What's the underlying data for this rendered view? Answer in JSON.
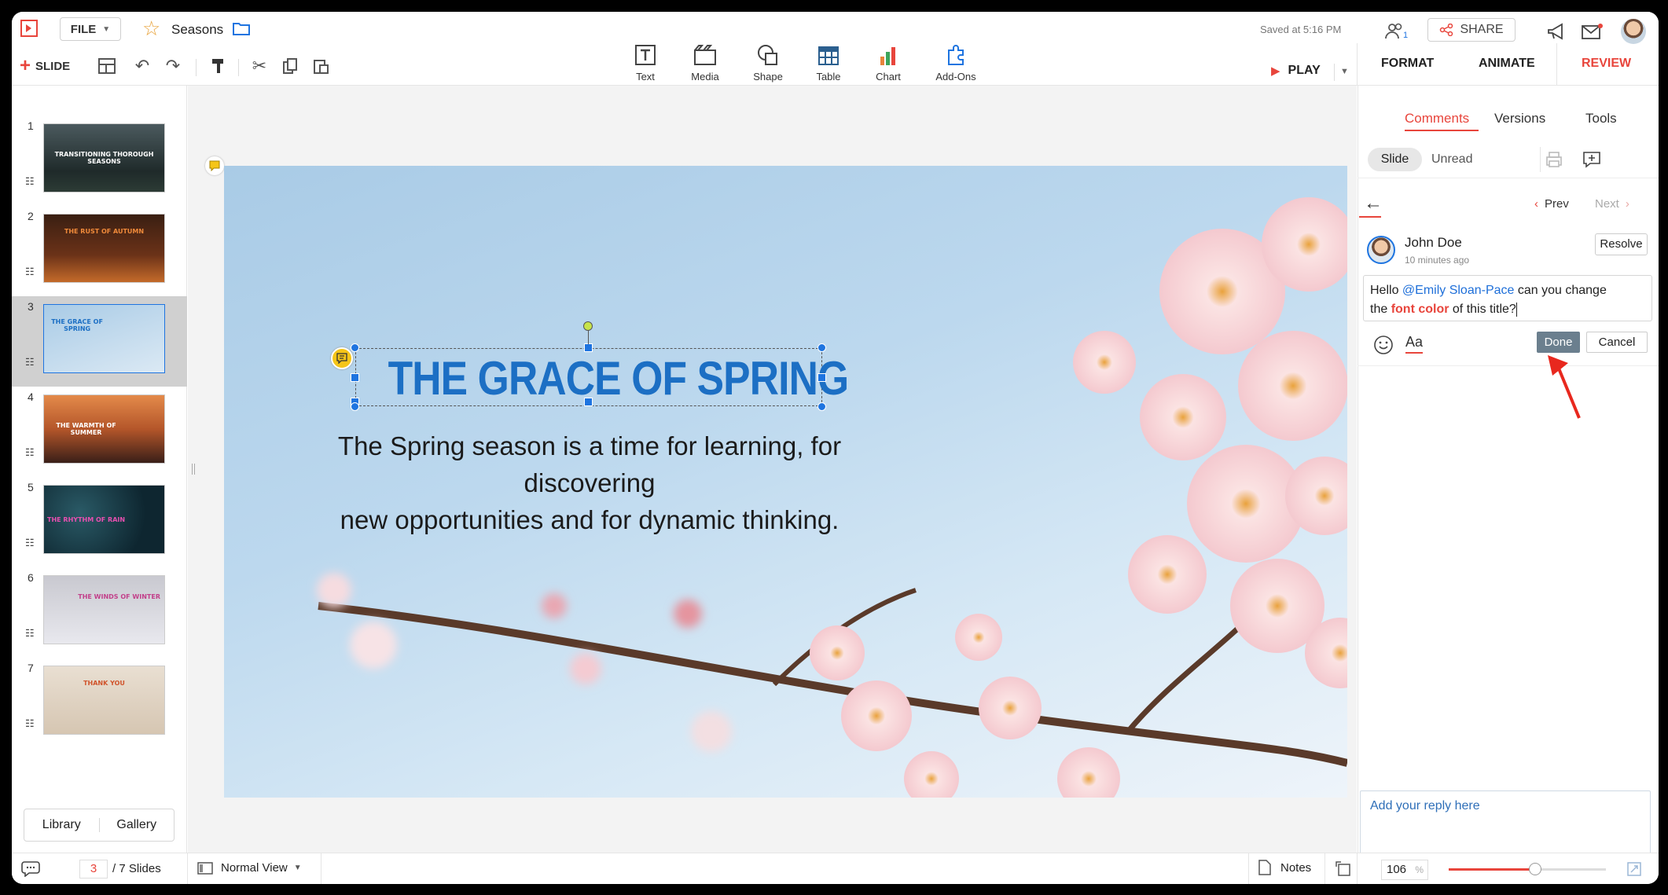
{
  "app": {
    "file_label": "FILE",
    "doc_title": "Seasons",
    "saved_status": "Saved at 5:16 PM",
    "slide_label": "SLIDE",
    "share_label": "SHARE",
    "collab_count": "1",
    "play_label": "PLAY"
  },
  "insert": [
    {
      "label": "Text",
      "icon": "text-icon"
    },
    {
      "label": "Media",
      "icon": "media-icon"
    },
    {
      "label": "Shape",
      "icon": "shape-icon"
    },
    {
      "label": "Table",
      "icon": "table-icon"
    },
    {
      "label": "Chart",
      "icon": "chart-icon"
    },
    {
      "label": "Add-Ons",
      "icon": "addons-icon"
    }
  ],
  "panel_tabs": {
    "format": "FORMAT",
    "animate": "ANIMATE",
    "review": "REVIEW"
  },
  "thumbs": [
    {
      "num": "1",
      "title": "TRANSITIONING THOROUGH SEASONS"
    },
    {
      "num": "2",
      "title": "THE RUST OF AUTUMN"
    },
    {
      "num": "3",
      "title": "THE GRACE OF SPRING"
    },
    {
      "num": "4",
      "title": "THE WARMTH OF SUMMER"
    },
    {
      "num": "5",
      "title": "THE RHYTHM OF RAIN"
    },
    {
      "num": "6",
      "title": "THE WINDS OF WINTER"
    },
    {
      "num": "7",
      "title": "THANK YOU"
    }
  ],
  "left_footer": {
    "library": "Library",
    "gallery": "Gallery"
  },
  "slide": {
    "title": "THE GRACE OF SPRING",
    "body_line1": "The Spring season is a time for learning, for discovering",
    "body_line2": "new opportunities and for dynamic thinking."
  },
  "review": {
    "tabs": [
      "Comments",
      "Versions",
      "Tools"
    ],
    "filter_slide": "Slide",
    "filter_unread": "Unread",
    "prev": "Prev",
    "next": "Next",
    "author": "John Doe",
    "time": "10 minutes ago",
    "resolve": "Resolve",
    "comment_hello": "Hello ",
    "comment_mention": "@Emily Sloan-Pace",
    "comment_mid": " can you change",
    "comment_the": "the ",
    "comment_bold": "font color",
    "comment_end": " of this title?",
    "format_aa": "Aa",
    "done": "Done",
    "cancel": "Cancel",
    "reply_placeholder": "Add your reply here"
  },
  "status": {
    "current_slide": "3",
    "total": "/ 7 Slides",
    "view": "Normal View",
    "notes": "Notes",
    "zoom": "106",
    "zoom_unit": "%",
    "zoom_level": 0.55
  },
  "colors": {
    "accent": "#e8453c",
    "title_blue": "#1c6fc4",
    "mention": "#1e6fd9"
  }
}
